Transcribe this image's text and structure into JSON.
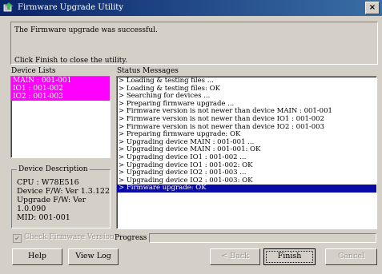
{
  "window": {
    "title": "Firmware Upgrade Utility",
    "close_glyph": "×"
  },
  "message": {
    "line1": "The Firmware upgrade was successful.",
    "line2": "Click Finish to close the utility."
  },
  "device_list": {
    "label": "Device Lists",
    "items": [
      "MAIN : 001-001",
      "IO1 : 001-002",
      "IO2 : 001-003"
    ]
  },
  "device_description": {
    "legend": "Device Description",
    "cpu": "CPU : W78E516",
    "device_fw": "Device F/W: Ver 1.3.122",
    "upgrade_fw": "Upgrade F/W: Ver 1.0.090",
    "mid": "MID: 001-001"
  },
  "status": {
    "label": "Status Messages",
    "lines": [
      "> Loading & testing files ...",
      "> Loading & testing files: OK",
      "> Searching for devices ...",
      "> Preparing firmware upgrade ...",
      "> Firmware version is not newer than device MAIN : 001-001",
      "> Firmware version is not newer than device IO1 : 001-002",
      "> Firmware version is not newer than device IO2 : 001-003",
      "> Preparing firmware upgrade: OK",
      "> Upgrading device MAIN : 001-001 ...",
      "> Upgrading device MAIN : 001-001: OK",
      "> Upgrading device IO1 : 001-002 ...",
      "> Upgrading device IO1 : 001-002: OK",
      "> Upgrading device IO2 : 001-003 ...",
      "> Upgrading device IO2 : 001-003: OK",
      "> Firmware upgrade: OK"
    ],
    "selected_index": 14
  },
  "check_firmware": {
    "label": "Check Firmware Version",
    "checked": true
  },
  "progress": {
    "label": "Progress",
    "value": 0
  },
  "buttons": {
    "help": "Help",
    "view_log": "View Log",
    "back": "< Back",
    "finish": "Finish",
    "cancel": "Cancel"
  },
  "colors": {
    "title_bar": "#0a246a",
    "device_highlight": "#ff00ff",
    "selection": "#0a0aa8",
    "dialog_bg": "#d4d0c8"
  }
}
